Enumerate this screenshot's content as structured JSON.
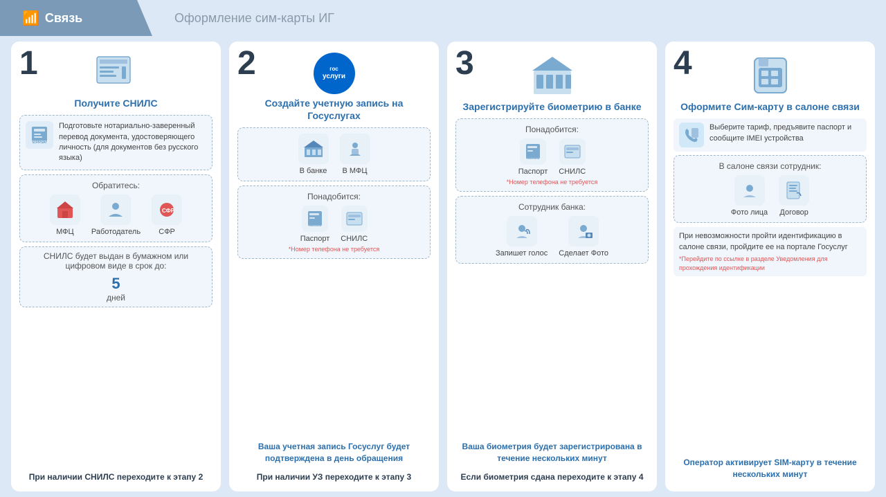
{
  "header": {
    "tab1_label": "Связь",
    "tab2_label": "Оформление сим-карты ИГ",
    "wifi_icon": "📶"
  },
  "steps": [
    {
      "number": "1",
      "title": "Получите СНИЛС",
      "doc_section_label": "Подготовьте нотариально-заверенный перевод документа, удостоверяющего личность (для документов без русского языка)",
      "contact_label": "Обратитесь:",
      "contacts": [
        "МФЦ",
        "Работодатель",
        "СФР"
      ],
      "result_label": "СНИЛС будет выдан в бумажном или цифровом виде в срок до:",
      "days": "5",
      "days_unit": "дней",
      "footer": "При наличии СНИЛС переходите к этапу 2"
    },
    {
      "number": "2",
      "title": "Создайте учетную запись на Госуслугах",
      "places_label": "В банке",
      "places_label2": "В МФЦ",
      "need_label": "Понадобится:",
      "docs": [
        "Паспорт",
        "СНИЛС"
      ],
      "note": "*Номер телефона не требуется",
      "result_text": "Ваша учетная запись Госуслуг будет подтверждена в день обращения",
      "footer": "При наличии УЗ переходите к этапу 3"
    },
    {
      "number": "3",
      "title": "Зарегистрируйте биометрию в банке",
      "need_label": "Понадобится:",
      "docs": [
        "Паспорт",
        "СНИЛС"
      ],
      "note": "*Номер телефона не требуется",
      "worker_label": "Сотрудник банка:",
      "actions": [
        "Запишет голос",
        "Сделает Фото"
      ],
      "result_text": "Ваша биометрия будет зарегистрирована в течение нескольких минут",
      "footer": "Если биометрия сдана переходите к этапу 4"
    },
    {
      "number": "4",
      "title": "Оформите Сим-карту в салоне связи",
      "instructions": "Выберите тариф, предъявите паспорт и сообщите IMEI устройства",
      "salon_label": "В салоне связи сотрудник:",
      "salon_actions": [
        "Фото лица",
        "Договор"
      ],
      "fail_text": "При невозможности пройти идентификацию в салоне связи, пройдите ее на портале Госуслуг",
      "note": "*Перейдите по ссылке в разделе Уведомления для прохождения идентификации",
      "result_text": "Оператор активирует SIM-карту в течение нескольких минут"
    }
  ]
}
